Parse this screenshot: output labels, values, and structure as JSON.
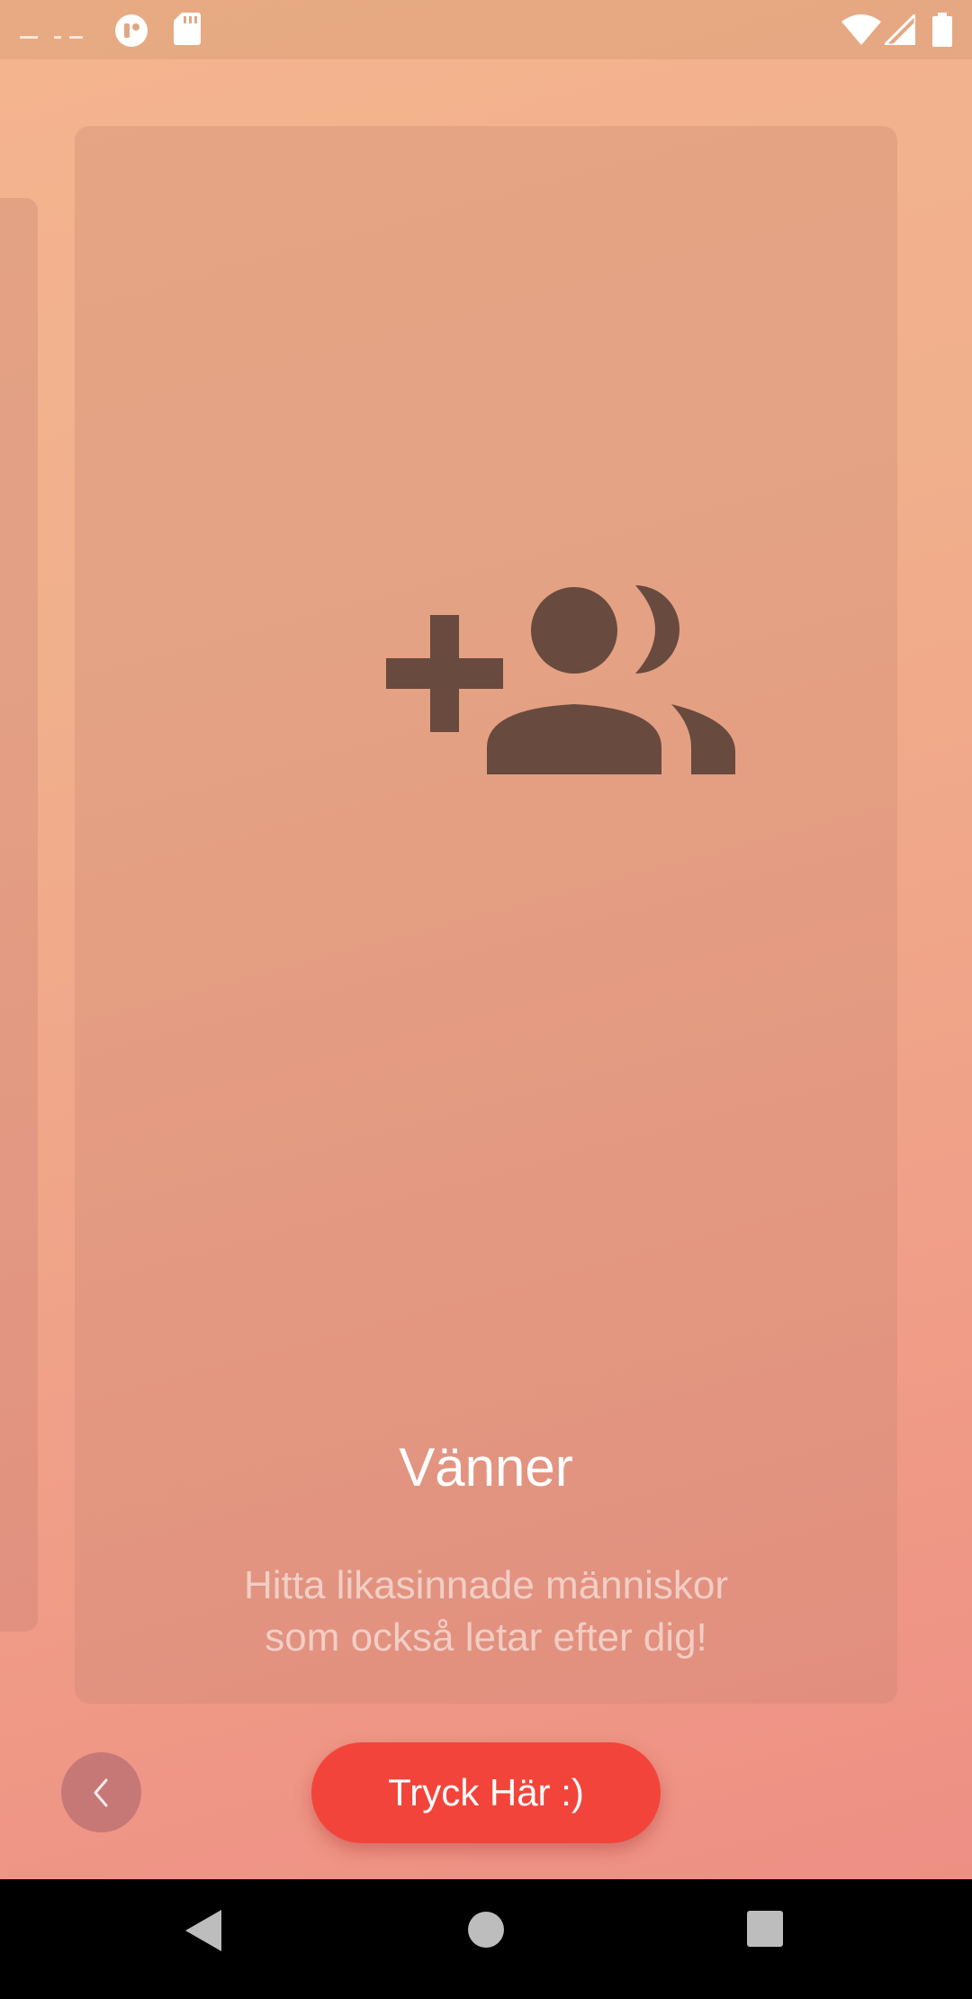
{
  "card": {
    "title": "Vänner",
    "description_line1": "Hitta likasinnade människor",
    "description_line2": "som också letar efter dig!"
  },
  "buttons": {
    "cta_label": "Tryck Här :)"
  },
  "icons": {
    "main": "group-add-icon",
    "back": "chevron-left-icon"
  },
  "colors": {
    "accent": "#f3443b",
    "icon": "#684a3e"
  }
}
